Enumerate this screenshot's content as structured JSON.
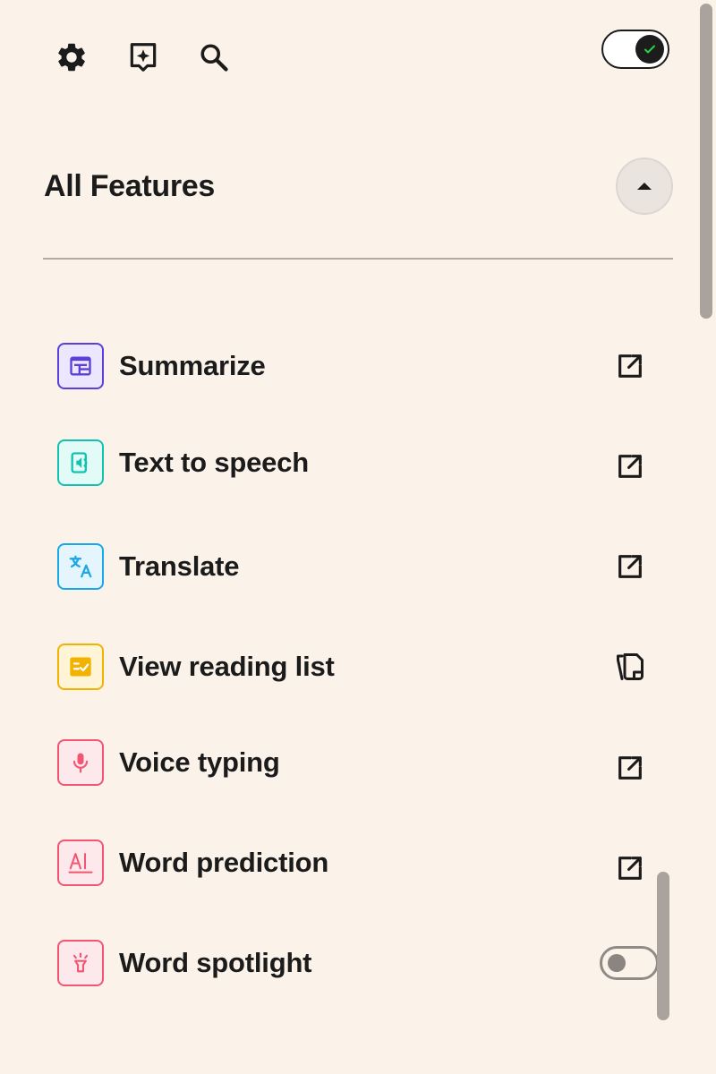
{
  "toolbar": {
    "settings_icon": "gear-icon",
    "ai_icon": "sparkle-bubble-icon",
    "search_icon": "search-icon",
    "master_toggle_on": true,
    "master_toggle_check_color": "#2bd14b"
  },
  "section": {
    "title": "All Features",
    "expanded": true
  },
  "features": [
    {
      "label": "Summarize",
      "icon": "summarize-icon",
      "color": "#5b3fd8",
      "bg": "#ece6ff",
      "action": "open-external-icon"
    },
    {
      "label": "Text to speech",
      "icon": "text-to-speech-icon",
      "color": "#12c2b0",
      "bg": "#e2fbf7",
      "action": "open-external-icon"
    },
    {
      "label": "Translate",
      "icon": "translate-icon",
      "color": "#1aa7e8",
      "bg": "#e4f5fd",
      "action": "open-external-icon"
    },
    {
      "label": "View reading list",
      "icon": "reading-list-icon",
      "color": "#f2b200",
      "bg": "#fff4d6",
      "action": "copy-pages-icon"
    },
    {
      "label": "Voice typing",
      "icon": "microphone-icon",
      "color": "#f25672",
      "bg": "#fde8ec",
      "action": "open-external-icon"
    },
    {
      "label": "Word prediction",
      "icon": "word-prediction-icon",
      "color": "#f25672",
      "bg": "#fde8ec",
      "action": "open-external-icon"
    },
    {
      "label": "Word spotlight",
      "icon": "spotlight-icon",
      "color": "#f25672",
      "bg": "#fde8ec",
      "action": "toggle",
      "toggle_on": false
    }
  ]
}
